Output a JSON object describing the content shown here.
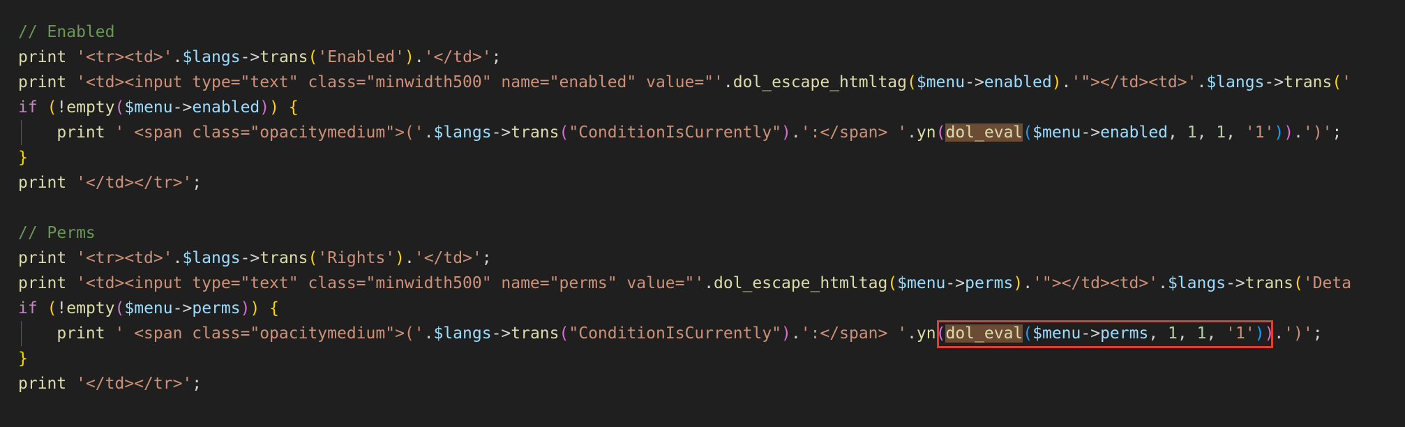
{
  "colors": {
    "background": "#1f1f1f",
    "default": "#d4d4d4",
    "comment": "#6a9955",
    "keyword": "#c586c0",
    "function": "#dcdcaa",
    "variable": "#9cdcfe",
    "string": "#ce9178",
    "number": "#b5cea8",
    "bracket_gold": "#ffd700",
    "bracket_pink": "#da70d6",
    "bracket_blue": "#179fff",
    "match_highlight": "#6b4b33",
    "annotation_box": "#e0412b"
  },
  "code": {
    "lines": [
      [
        {
          "t": "// Enabled",
          "c": "comment"
        }
      ],
      [
        {
          "t": "print",
          "c": "function"
        },
        {
          "t": " ",
          "c": "default"
        },
        {
          "t": "'<tr><td>'",
          "c": "string"
        },
        {
          "t": ".",
          "c": "default"
        },
        {
          "t": "$langs",
          "c": "variable"
        },
        {
          "t": "->",
          "c": "default"
        },
        {
          "t": "trans",
          "c": "function"
        },
        {
          "t": "(",
          "c": "bracket_gold"
        },
        {
          "t": "'Enabled'",
          "c": "string"
        },
        {
          "t": ")",
          "c": "bracket_gold"
        },
        {
          "t": ".",
          "c": "default"
        },
        {
          "t": "'</td>'",
          "c": "string"
        },
        {
          "t": ";",
          "c": "default"
        }
      ],
      [
        {
          "t": "print",
          "c": "function"
        },
        {
          "t": " ",
          "c": "default"
        },
        {
          "t": "'<td><input type=\"text\" class=\"minwidth500\" name=\"enabled\" value=\"'",
          "c": "string"
        },
        {
          "t": ".",
          "c": "default"
        },
        {
          "t": "dol_escape_htmltag",
          "c": "function"
        },
        {
          "t": "(",
          "c": "bracket_gold"
        },
        {
          "t": "$menu",
          "c": "variable"
        },
        {
          "t": "->",
          "c": "default"
        },
        {
          "t": "enabled",
          "c": "variable"
        },
        {
          "t": ")",
          "c": "bracket_gold"
        },
        {
          "t": ".",
          "c": "default"
        },
        {
          "t": "'\"></td><td>'",
          "c": "string"
        },
        {
          "t": ".",
          "c": "default"
        },
        {
          "t": "$langs",
          "c": "variable"
        },
        {
          "t": "->",
          "c": "default"
        },
        {
          "t": "trans",
          "c": "function"
        },
        {
          "t": "(",
          "c": "bracket_gold"
        },
        {
          "t": "'",
          "c": "string"
        }
      ],
      [
        {
          "t": "if",
          "c": "keyword"
        },
        {
          "t": " ",
          "c": "default"
        },
        {
          "t": "(",
          "c": "bracket_gold"
        },
        {
          "t": "!",
          "c": "default"
        },
        {
          "t": "empty",
          "c": "function"
        },
        {
          "t": "(",
          "c": "bracket_pink"
        },
        {
          "t": "$menu",
          "c": "variable"
        },
        {
          "t": "->",
          "c": "default"
        },
        {
          "t": "enabled",
          "c": "variable"
        },
        {
          "t": ")",
          "c": "bracket_pink"
        },
        {
          "t": ")",
          "c": "bracket_gold"
        },
        {
          "t": " ",
          "c": "default"
        },
        {
          "t": "{",
          "c": "bracket_gold"
        }
      ],
      [
        {
          "t": "    ",
          "c": "default",
          "guide": true
        },
        {
          "t": "print",
          "c": "function"
        },
        {
          "t": " ",
          "c": "default"
        },
        {
          "t": "' <span class=\"opacitymedium\">('",
          "c": "string"
        },
        {
          "t": ".",
          "c": "default"
        },
        {
          "t": "$langs",
          "c": "variable"
        },
        {
          "t": "->",
          "c": "default"
        },
        {
          "t": "trans",
          "c": "function"
        },
        {
          "t": "(",
          "c": "bracket_pink"
        },
        {
          "t": "\"ConditionIsCurrently\"",
          "c": "string"
        },
        {
          "t": ")",
          "c": "bracket_pink"
        },
        {
          "t": ".",
          "c": "default"
        },
        {
          "t": "':</span> '",
          "c": "string"
        },
        {
          "t": ".",
          "c": "default"
        },
        {
          "t": "yn",
          "c": "function"
        },
        {
          "t": "(",
          "c": "bracket_pink"
        },
        {
          "t": "dol_eval",
          "c": "function",
          "hl": true
        },
        {
          "t": "(",
          "c": "bracket_blue"
        },
        {
          "t": "$menu",
          "c": "variable"
        },
        {
          "t": "->",
          "c": "default"
        },
        {
          "t": "enabled",
          "c": "variable"
        },
        {
          "t": ", ",
          "c": "default"
        },
        {
          "t": "1",
          "c": "number"
        },
        {
          "t": ", ",
          "c": "default"
        },
        {
          "t": "1",
          "c": "number"
        },
        {
          "t": ", ",
          "c": "default"
        },
        {
          "t": "'1'",
          "c": "string"
        },
        {
          "t": ")",
          "c": "bracket_blue"
        },
        {
          "t": ")",
          "c": "bracket_pink"
        },
        {
          "t": ".",
          "c": "default"
        },
        {
          "t": "')'",
          "c": "string"
        },
        {
          "t": ";",
          "c": "default"
        }
      ],
      [
        {
          "t": "}",
          "c": "bracket_gold"
        }
      ],
      [
        {
          "t": "print",
          "c": "function"
        },
        {
          "t": " ",
          "c": "default"
        },
        {
          "t": "'</td></tr>'",
          "c": "string"
        },
        {
          "t": ";",
          "c": "default"
        }
      ],
      [],
      [
        {
          "t": "// Perms",
          "c": "comment"
        }
      ],
      [
        {
          "t": "print",
          "c": "function"
        },
        {
          "t": " ",
          "c": "default"
        },
        {
          "t": "'<tr><td>'",
          "c": "string"
        },
        {
          "t": ".",
          "c": "default"
        },
        {
          "t": "$langs",
          "c": "variable"
        },
        {
          "t": "->",
          "c": "default"
        },
        {
          "t": "trans",
          "c": "function"
        },
        {
          "t": "(",
          "c": "bracket_gold"
        },
        {
          "t": "'Rights'",
          "c": "string"
        },
        {
          "t": ")",
          "c": "bracket_gold"
        },
        {
          "t": ".",
          "c": "default"
        },
        {
          "t": "'</td>'",
          "c": "string"
        },
        {
          "t": ";",
          "c": "default"
        }
      ],
      [
        {
          "t": "print",
          "c": "function"
        },
        {
          "t": " ",
          "c": "default"
        },
        {
          "t": "'<td><input type=\"text\" class=\"minwidth500\" name=\"perms\" value=\"'",
          "c": "string"
        },
        {
          "t": ".",
          "c": "default"
        },
        {
          "t": "dol_escape_htmltag",
          "c": "function"
        },
        {
          "t": "(",
          "c": "bracket_gold"
        },
        {
          "t": "$menu",
          "c": "variable"
        },
        {
          "t": "->",
          "c": "default"
        },
        {
          "t": "perms",
          "c": "variable"
        },
        {
          "t": ")",
          "c": "bracket_gold"
        },
        {
          "t": ".",
          "c": "default"
        },
        {
          "t": "'\"></td><td>'",
          "c": "string"
        },
        {
          "t": ".",
          "c": "default"
        },
        {
          "t": "$langs",
          "c": "variable"
        },
        {
          "t": "->",
          "c": "default"
        },
        {
          "t": "trans",
          "c": "function"
        },
        {
          "t": "(",
          "c": "bracket_gold"
        },
        {
          "t": "'Deta",
          "c": "string"
        }
      ],
      [
        {
          "t": "if",
          "c": "keyword"
        },
        {
          "t": " ",
          "c": "default"
        },
        {
          "t": "(",
          "c": "bracket_gold"
        },
        {
          "t": "!",
          "c": "default"
        },
        {
          "t": "empty",
          "c": "function"
        },
        {
          "t": "(",
          "c": "bracket_pink"
        },
        {
          "t": "$menu",
          "c": "variable"
        },
        {
          "t": "->",
          "c": "default"
        },
        {
          "t": "perms",
          "c": "variable"
        },
        {
          "t": ")",
          "c": "bracket_pink"
        },
        {
          "t": ")",
          "c": "bracket_gold"
        },
        {
          "t": " ",
          "c": "default"
        },
        {
          "t": "{",
          "c": "bracket_gold"
        }
      ],
      [
        {
          "t": "    ",
          "c": "default",
          "guide": true
        },
        {
          "t": "print",
          "c": "function"
        },
        {
          "t": " ",
          "c": "default"
        },
        {
          "t": "' <span class=\"opacitymedium\">('",
          "c": "string"
        },
        {
          "t": ".",
          "c": "default"
        },
        {
          "t": "$langs",
          "c": "variable"
        },
        {
          "t": "->",
          "c": "default"
        },
        {
          "t": "trans",
          "c": "function"
        },
        {
          "t": "(",
          "c": "bracket_pink"
        },
        {
          "t": "\"ConditionIsCurrently\"",
          "c": "string"
        },
        {
          "t": ")",
          "c": "bracket_pink"
        },
        {
          "t": ".",
          "c": "default"
        },
        {
          "t": "':</span> '",
          "c": "string"
        },
        {
          "t": ".",
          "c": "default"
        },
        {
          "t": "yn",
          "c": "function"
        },
        {
          "t": "(",
          "c": "bracket_pink"
        },
        {
          "t": "dol_eval",
          "c": "function",
          "hl": true,
          "boxStart": true
        },
        {
          "t": "(",
          "c": "bracket_blue"
        },
        {
          "t": "$menu",
          "c": "variable"
        },
        {
          "t": "->",
          "c": "default"
        },
        {
          "t": "perms",
          "c": "variable"
        },
        {
          "t": ", ",
          "c": "default"
        },
        {
          "t": "1",
          "c": "number"
        },
        {
          "t": ", ",
          "c": "default"
        },
        {
          "t": "1",
          "c": "number"
        },
        {
          "t": ", ",
          "c": "default"
        },
        {
          "t": "'1'",
          "c": "string"
        },
        {
          "t": ")",
          "c": "bracket_blue",
          "boxEnd": true
        },
        {
          "t": ")",
          "c": "bracket_pink"
        },
        {
          "t": ".",
          "c": "default"
        },
        {
          "t": "')'",
          "c": "string"
        },
        {
          "t": ";",
          "c": "default"
        }
      ],
      [
        {
          "t": "}",
          "c": "bracket_gold"
        }
      ],
      [
        {
          "t": "print",
          "c": "function"
        },
        {
          "t": " ",
          "c": "default"
        },
        {
          "t": "'</td></tr>'",
          "c": "string"
        },
        {
          "t": ";",
          "c": "default"
        }
      ]
    ]
  }
}
